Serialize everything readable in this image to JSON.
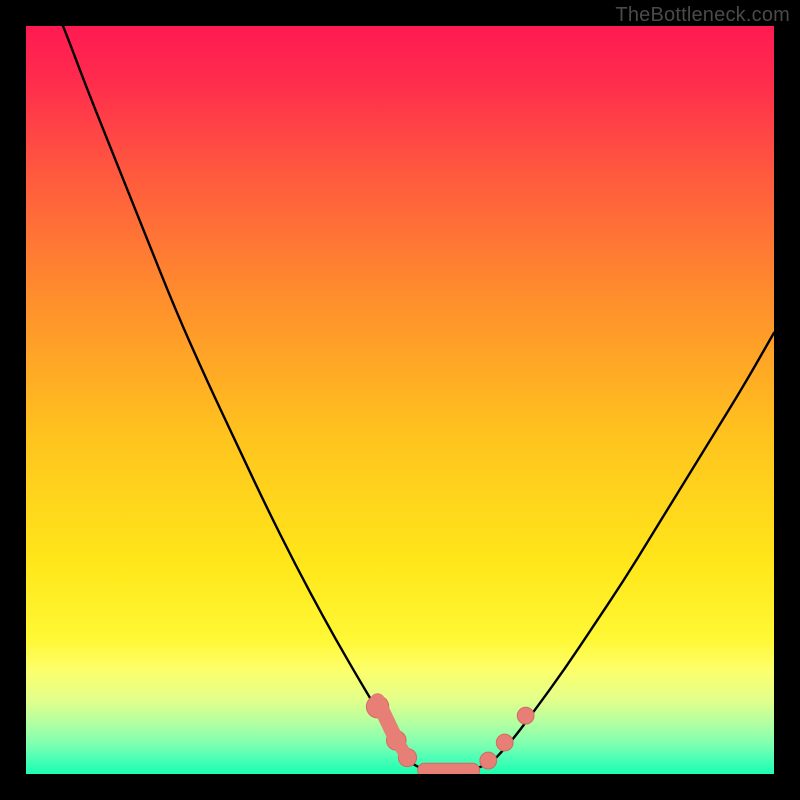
{
  "watermark": "TheBottleneck.com",
  "colors": {
    "frame": "#000000",
    "curve": "#000000",
    "marker_fill": "#e77f77",
    "marker_stroke": "#d46a62",
    "gradient_stops": [
      {
        "offset": "0%",
        "color": "#ff1a52"
      },
      {
        "offset": "7%",
        "color": "#ff2b4d"
      },
      {
        "offset": "20%",
        "color": "#ff5a3e"
      },
      {
        "offset": "35%",
        "color": "#ff8a2e"
      },
      {
        "offset": "55%",
        "color": "#ffc41e"
      },
      {
        "offset": "72%",
        "color": "#ffe71a"
      },
      {
        "offset": "82%",
        "color": "#fff835"
      },
      {
        "offset": "86%",
        "color": "#fdff6a"
      },
      {
        "offset": "90%",
        "color": "#e3ff8a"
      },
      {
        "offset": "93%",
        "color": "#b6ffa0"
      },
      {
        "offset": "96%",
        "color": "#7effb0"
      },
      {
        "offset": "98%",
        "color": "#4affb6"
      },
      {
        "offset": "100%",
        "color": "#1affb0"
      }
    ]
  },
  "chart_data": {
    "type": "line",
    "title": "",
    "xlabel": "",
    "ylabel": "",
    "xlim": [
      0,
      100
    ],
    "ylim": [
      0,
      100
    ],
    "note": "Bottleneck-style V-curve. x is an arbitrary component-ratio axis (0–100); y is bottleneck percentage (0–100, 0 = no bottleneck = green bottom). Values are estimated from pixel positions.",
    "series": [
      {
        "name": "left-branch",
        "x": [
          0,
          5,
          8,
          12,
          16,
          20,
          24,
          28,
          32,
          36,
          40,
          44,
          47,
          50,
          51.5
        ],
        "y": [
          112,
          100,
          92,
          82,
          72,
          62,
          53,
          44.5,
          36,
          28,
          20.5,
          13.5,
          8.5,
          3.5,
          1.5
        ]
      },
      {
        "name": "valley",
        "x": [
          51.5,
          53,
          55,
          57,
          59,
          61,
          62.5
        ],
        "y": [
          1.5,
          0.6,
          0.2,
          0.2,
          0.4,
          1.0,
          1.8
        ]
      },
      {
        "name": "right-branch",
        "x": [
          62.5,
          65,
          68,
          72,
          76,
          80,
          84,
          88,
          92,
          96,
          100
        ],
        "y": [
          1.8,
          4.5,
          8.5,
          14,
          20,
          26,
          32.5,
          39,
          45.5,
          52,
          59
        ]
      }
    ],
    "markers": {
      "name": "highlighted-segment",
      "comment": "Pink rounded markers near the valley floor",
      "points": [
        {
          "x": 47.0,
          "y": 9.0,
          "r": 1.6
        },
        {
          "x": 49.5,
          "y": 4.5,
          "r": 1.4
        },
        {
          "x": 51.0,
          "y": 2.2,
          "r": 1.3
        },
        {
          "x": 56.5,
          "y": 0.5,
          "r": 1.2,
          "elongated": true
        },
        {
          "x": 61.8,
          "y": 1.8,
          "r": 1.2
        },
        {
          "x": 64.0,
          "y": 4.2,
          "r": 1.2
        },
        {
          "x": 66.8,
          "y": 7.8,
          "r": 1.2
        }
      ]
    }
  }
}
